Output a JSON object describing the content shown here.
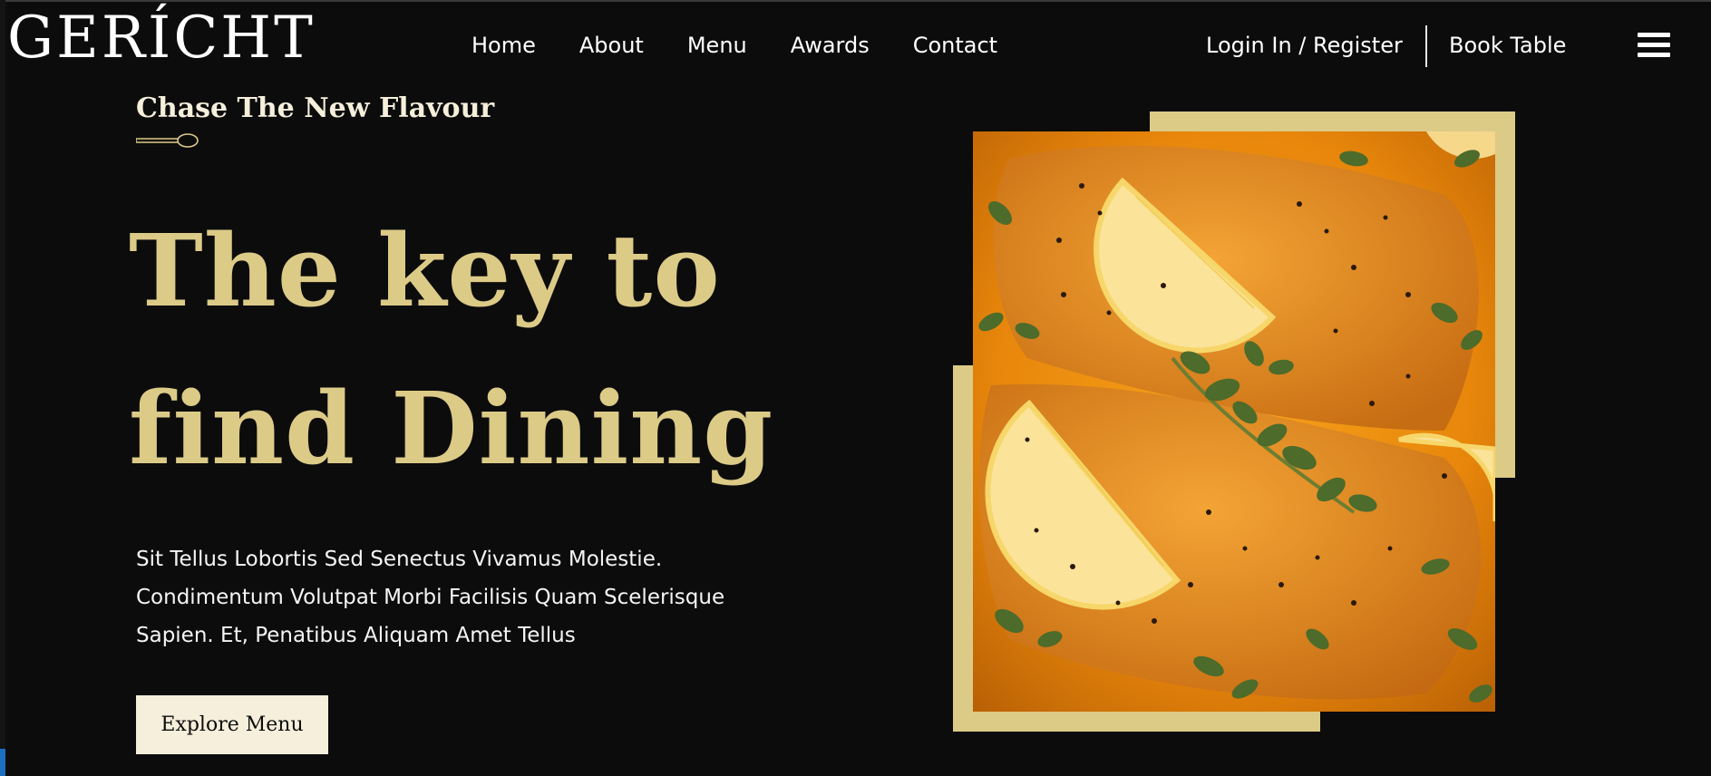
{
  "brand": {
    "logo": "GERÍCHT"
  },
  "nav": {
    "items": [
      "Home",
      "About",
      "Menu",
      "Awards",
      "Contact"
    ]
  },
  "header": {
    "auth_label": "Login In / Register",
    "book_label": "Book Table",
    "menu_icon": "hamburger-icon"
  },
  "hero": {
    "subtitle": "Chase The New Flavour",
    "headline_line1": "The key to",
    "headline_line2": "find Dining",
    "description": "Sit Tellus Lobortis Sed Senectus Vivamus Molestie. Condimentum Volutpat Morbi Facilisis Quam Scelerisque Sapien. Et, Penatibus Aliquam Amet Tellus",
    "cta_label": "Explore Menu"
  },
  "colors": {
    "background": "#0c0c0c",
    "gold": "#dcca87",
    "cream": "#f5efdb",
    "white": "#ffffff"
  }
}
